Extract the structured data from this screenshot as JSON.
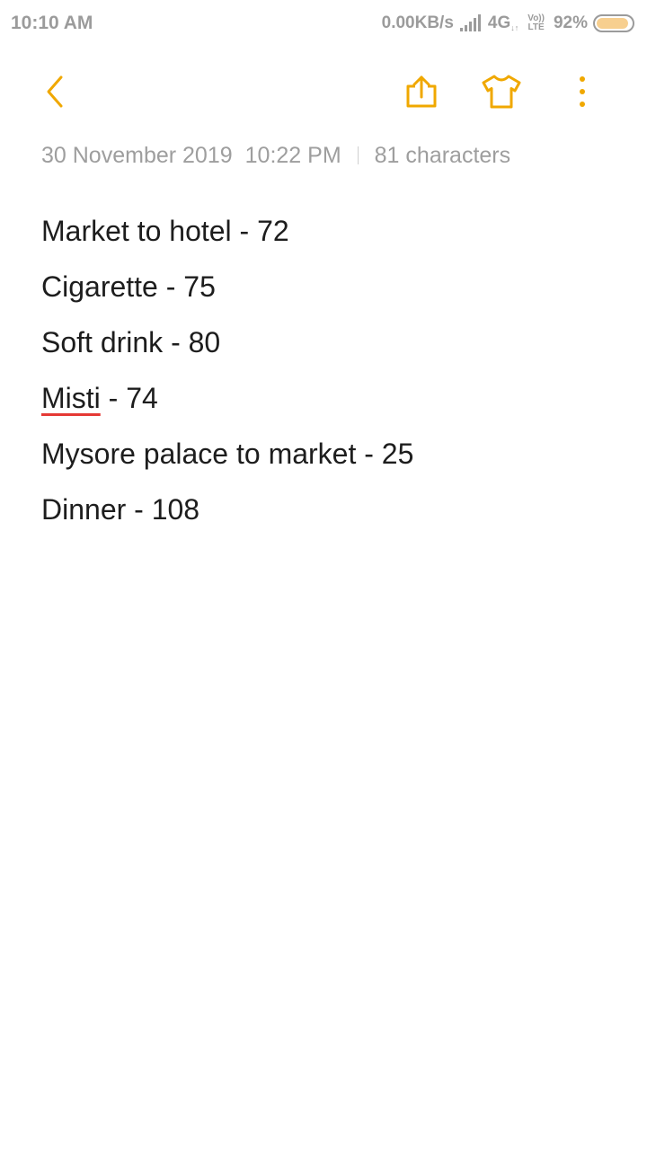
{
  "status_bar": {
    "time": "10:10 AM",
    "net_speed": "0.00KB/s",
    "network_type": "4G",
    "network_arrows": "↓↑",
    "volte_top": "Vo))",
    "volte_bottom": "LTE",
    "battery_percent": "92%",
    "battery_level": 0.92,
    "icons": [
      "signal-icon",
      "battery-icon"
    ]
  },
  "toolbar": {
    "accent_color": "#f0a800",
    "icons": [
      "back-icon",
      "share-icon",
      "tshirt-icon",
      "more-icon"
    ]
  },
  "meta": {
    "date": "30 November 2019",
    "time": "10:22 PM",
    "characters": "81 characters"
  },
  "note": {
    "lines": [
      {
        "text": "Market to hotel - 72"
      },
      {
        "text": "Cigarette - 75"
      },
      {
        "text": "Soft drink - 80"
      },
      {
        "prefix": "Misti",
        "suffix": " - 74",
        "prefix_spell_error": true
      },
      {
        "text": "Mysore palace to market - 25"
      },
      {
        "text": "Dinner - 108"
      }
    ],
    "spell_error_color": "#e53935"
  }
}
